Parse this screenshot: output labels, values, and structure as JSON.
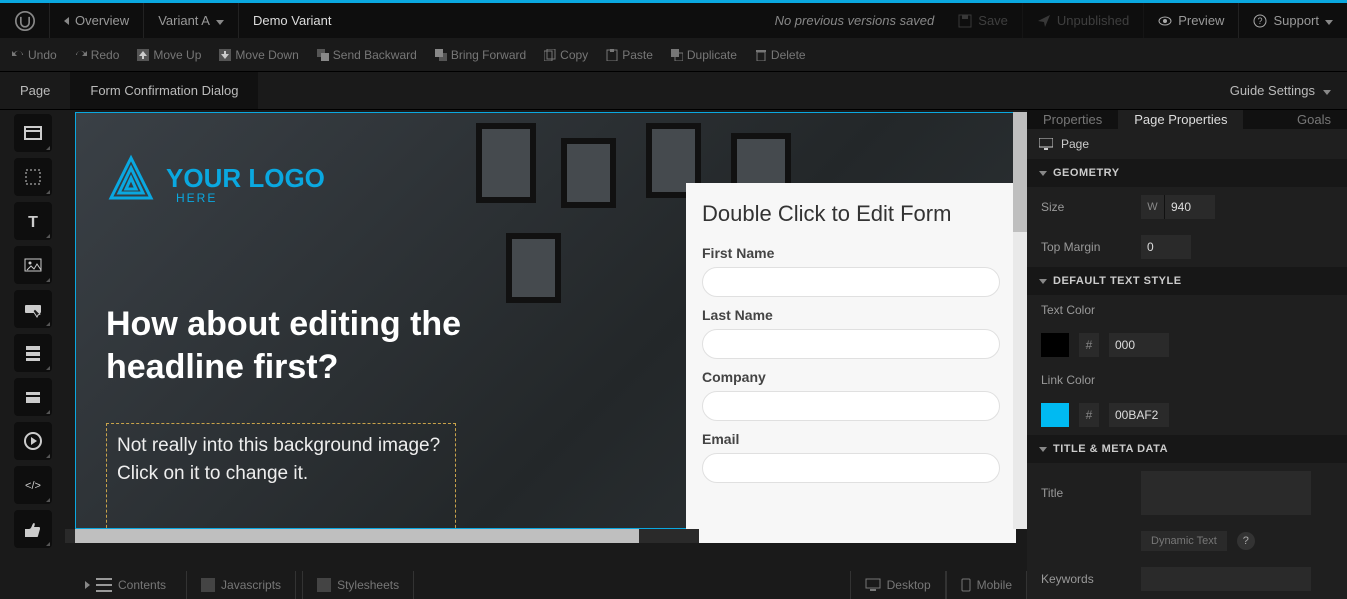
{
  "top": {
    "overview": "Overview",
    "variant": "Variant A",
    "title": "Demo Variant",
    "status": "No previous versions saved",
    "save": "Save",
    "unpublished": "Unpublished",
    "preview": "Preview",
    "support": "Support"
  },
  "toolbar": {
    "undo": "Undo",
    "redo": "Redo",
    "moveUp": "Move Up",
    "moveDown": "Move Down",
    "sendBackward": "Send Backward",
    "bringForward": "Bring Forward",
    "copy": "Copy",
    "paste": "Paste",
    "duplicate": "Duplicate",
    "delete": "Delete"
  },
  "tabs": {
    "page": "Page",
    "formConfirm": "Form Confirmation Dialog",
    "guide": "Guide Settings"
  },
  "leftTools": [
    "section",
    "box",
    "text",
    "image",
    "embed",
    "block",
    "form",
    "video",
    "code",
    "thumbs"
  ],
  "canvas": {
    "logoMain": "YOUR LOGO",
    "logoSub": "HERE",
    "headline": "How about editing the headline first?",
    "subtext": "Not really into this background image? Click on it to change it.",
    "formTitle": "Double Click to Edit Form",
    "fields": [
      "First Name",
      "Last Name",
      "Company",
      "Email"
    ]
  },
  "bottom": {
    "contents": "Contents",
    "js": "Javascripts",
    "css": "Stylesheets",
    "desktop": "Desktop",
    "mobile": "Mobile"
  },
  "panel": {
    "tabProperties": "Properties",
    "tabPageProps": "Page Properties",
    "tabGoals": "Goals",
    "pageLabel": "Page",
    "geometry": "GEOMETRY",
    "size": "Size",
    "sizeW": "W",
    "sizeVal": "940",
    "topMargin": "Top Margin",
    "topMarginVal": "0",
    "textStyle": "DEFAULT TEXT STYLE",
    "textColor": "Text Color",
    "textColorVal": "000",
    "textColorHex": "#000000",
    "linkColor": "Link Color",
    "linkColorVal": "00BAF2",
    "linkColorHex": "#00BAF2",
    "meta": "TITLE & META DATA",
    "title": "Title",
    "dynamic": "Dynamic Text",
    "keywords": "Keywords"
  }
}
